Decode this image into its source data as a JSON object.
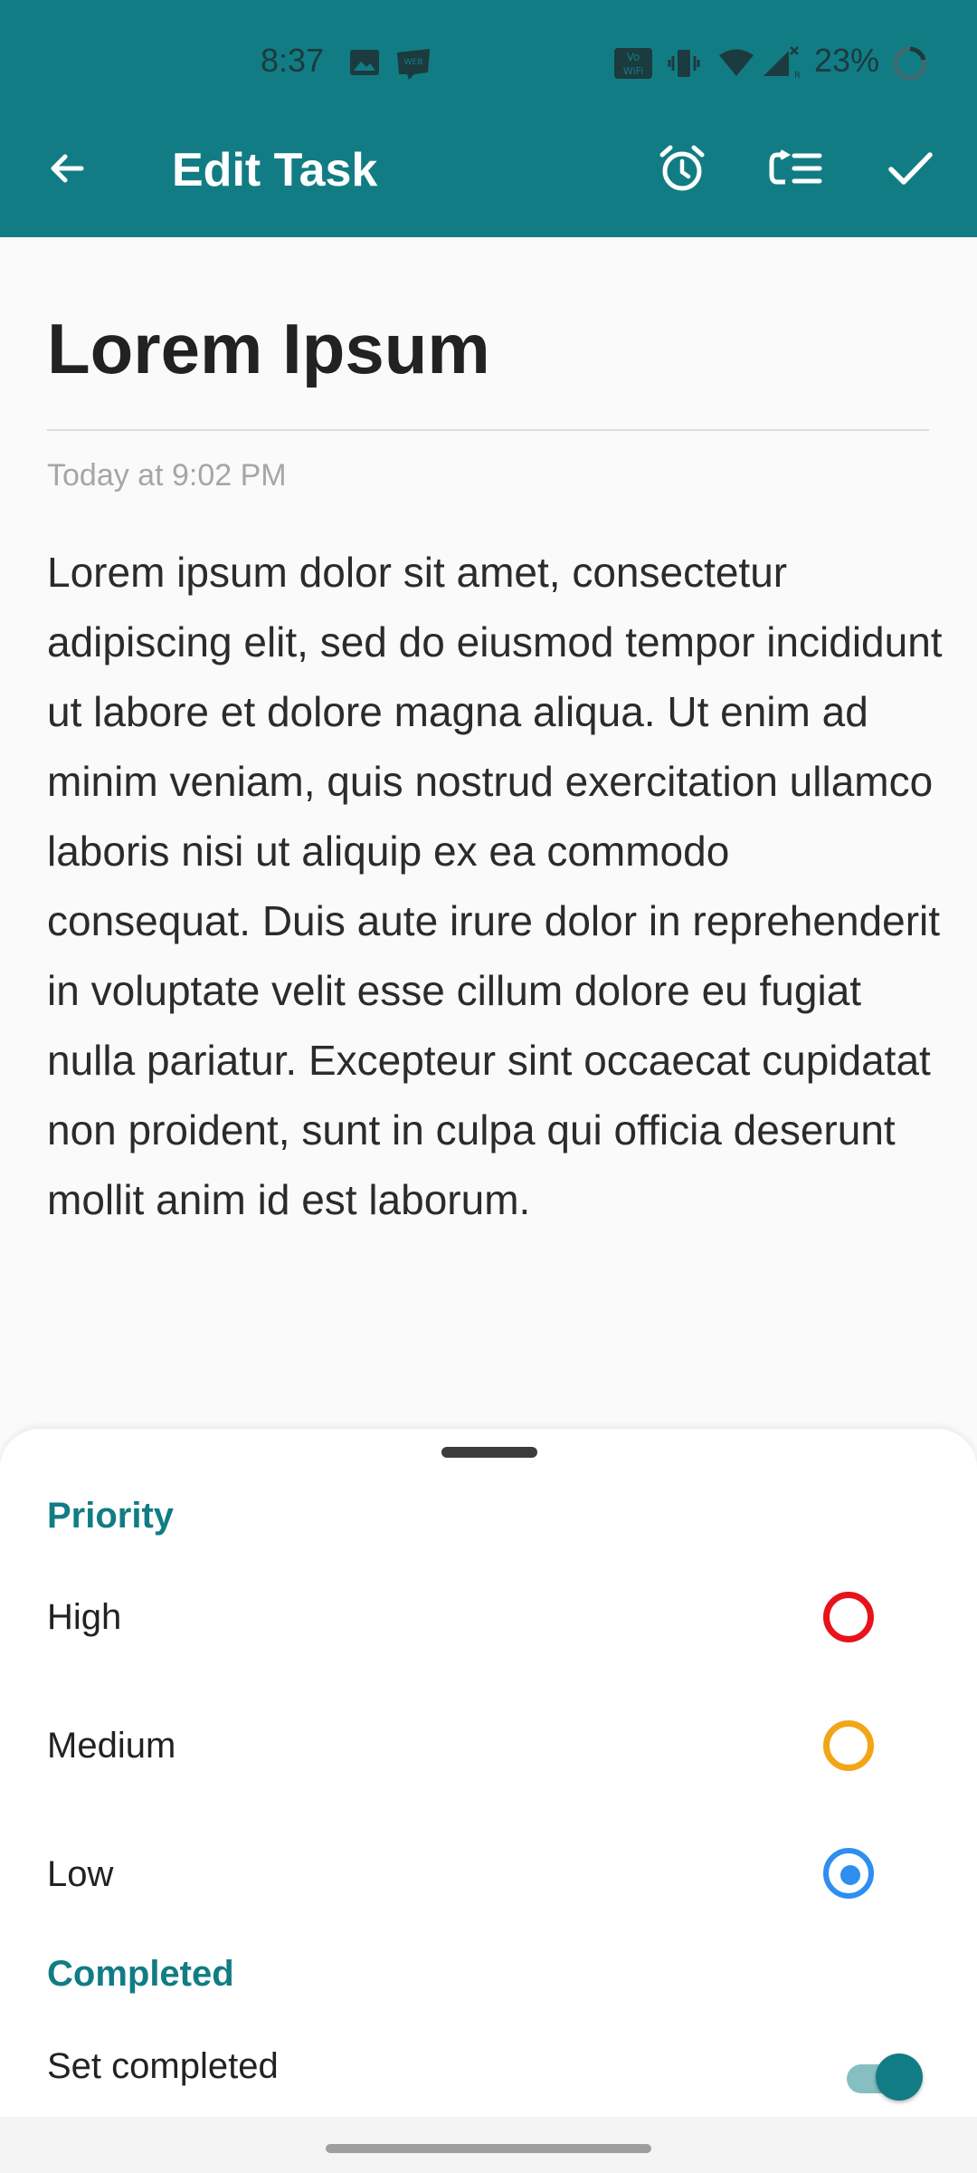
{
  "status_bar": {
    "time": "8:37",
    "battery_percent": "23%",
    "icons": [
      "image-icon",
      "webtoon-icon",
      "vowifi-icon",
      "vibrate-icon",
      "wifi-icon",
      "signal-icon",
      "battery-icon"
    ]
  },
  "toolbar": {
    "title": "Edit Task",
    "actions": [
      "back-arrow-icon",
      "alarm-icon",
      "checklist-icon",
      "check-icon"
    ]
  },
  "task": {
    "title": "Lorem Ipsum",
    "timestamp": "Today at 9:02 PM",
    "body": "Lorem ipsum dolor sit amet, consectetur adipiscing elit, sed do eiusmod tempor incididunt ut labore et dolore magna aliqua. Ut enim ad minim veniam, quis nostrud exercitation ullamco laboris nisi ut aliquip ex ea commodo consequat. Duis aute irure dolor in reprehenderit in voluptate velit esse cillum dolore eu fugiat nulla pariatur. Excepteur sint occaecat cupidatat non proident, sunt in culpa qui officia deserunt mollit anim id est laborum."
  },
  "sheet": {
    "priority_label": "Priority",
    "priorities": [
      {
        "label": "High",
        "color": "#e8131a",
        "selected": false
      },
      {
        "label": "Medium",
        "color": "#f2a516",
        "selected": false
      },
      {
        "label": "Low",
        "color": "#2f8ef0",
        "selected": true
      }
    ],
    "completed_label": "Completed",
    "set_completed_label": "Set completed",
    "set_completed_on": true
  },
  "colors": {
    "accent": "#127c84"
  }
}
